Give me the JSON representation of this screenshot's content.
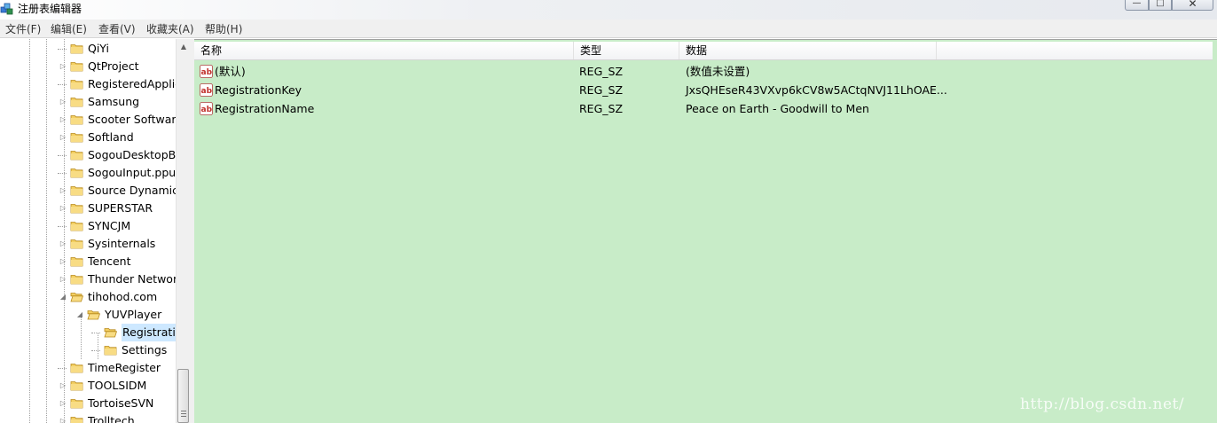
{
  "window": {
    "title": "注册表编辑器",
    "controls": {
      "minimize": "—",
      "maximize": "□",
      "close": "✕"
    }
  },
  "menu": [
    "文件(F)",
    "编辑(E)",
    "查看(V)",
    "收藏夹(A)",
    "帮助(H)"
  ],
  "tree": {
    "nodes": [
      {
        "label": "QiYi"
      },
      {
        "label": "QtProject"
      },
      {
        "label": "RegisteredApplic"
      },
      {
        "label": "Samsung"
      },
      {
        "label": "Scooter Software"
      },
      {
        "label": "Softland"
      },
      {
        "label": "SogouDesktopB"
      },
      {
        "label": "SogouInput.ppu"
      },
      {
        "label": "Source Dynamics"
      },
      {
        "label": "SUPERSTAR"
      },
      {
        "label": "SYNCJM"
      },
      {
        "label": "Sysinternals"
      },
      {
        "label": "Tencent"
      },
      {
        "label": "Thunder Networ"
      },
      {
        "label": "tihohod.com"
      },
      {
        "label": "YUVPlayer"
      },
      {
        "label": "Registratio"
      },
      {
        "label": "Settings"
      },
      {
        "label": "TimeRegister"
      },
      {
        "label": "TOOLSIDM"
      },
      {
        "label": "TortoiseSVN"
      },
      {
        "label": "Trolltech"
      }
    ]
  },
  "list": {
    "columns": [
      "名称",
      "类型",
      "数据"
    ],
    "rows": [
      {
        "name": "(默认)",
        "type": "REG_SZ",
        "data": "(数值未设置)"
      },
      {
        "name": "RegistrationKey",
        "type": "REG_SZ",
        "data": "JxsQHEseR43VXvp6kCV8w5ACtqNVJ11LhOAE..."
      },
      {
        "name": "RegistrationName",
        "type": "REG_SZ",
        "data": "Peace on Earth - Goodwill to Men"
      }
    ]
  },
  "watermark": "http://blog.csdn.net/",
  "colors": {
    "list_background": "#c8ecc8",
    "selection": "#cde8ff"
  }
}
